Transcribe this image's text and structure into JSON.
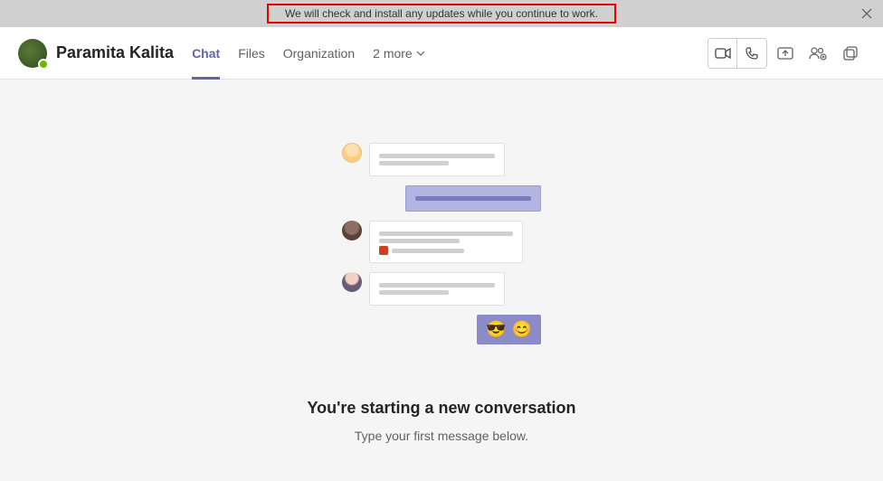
{
  "banner": {
    "text": "We will check and install any updates while you continue to work."
  },
  "header": {
    "contact_name": "Paramita Kalita",
    "tabs": {
      "chat": "Chat",
      "files": "Files",
      "organization": "Organization",
      "more": "2 more"
    }
  },
  "empty_state": {
    "heading": "You're starting a new conversation",
    "subtext": "Type your first message below."
  },
  "emoji": {
    "cool": "😎",
    "smile": "😊"
  }
}
